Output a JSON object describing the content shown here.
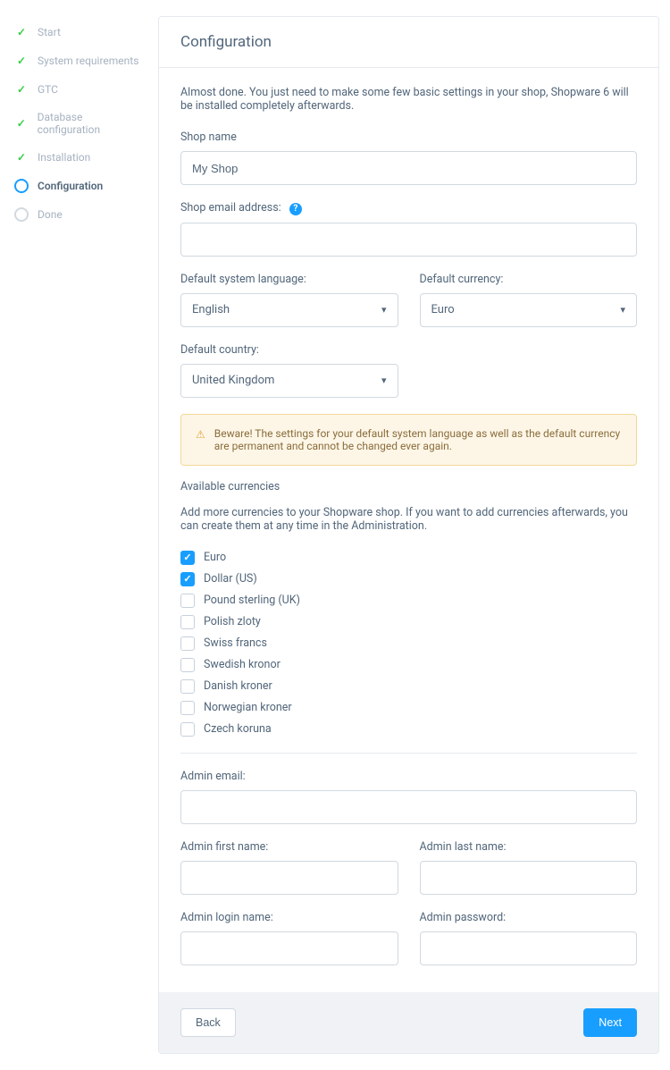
{
  "sidebar": {
    "steps": [
      {
        "label": "Start",
        "state": "done"
      },
      {
        "label": "System requirements",
        "state": "done"
      },
      {
        "label": "GTC",
        "state": "done"
      },
      {
        "label": "Database configuration",
        "state": "done"
      },
      {
        "label": "Installation",
        "state": "done"
      },
      {
        "label": "Configuration",
        "state": "current"
      },
      {
        "label": "Done",
        "state": "pending"
      }
    ]
  },
  "header": {
    "title": "Configuration"
  },
  "intro": "Almost done. You just need to make some few basic settings in your shop, Shopware 6 will be installed completely afterwards.",
  "form": {
    "shop_name_label": "Shop name",
    "shop_name_value": "My Shop",
    "shop_email_label": "Shop email address:",
    "shop_email_value": "",
    "default_lang_label": "Default system language:",
    "default_lang_value": "English",
    "default_currency_label": "Default currency:",
    "default_currency_value": "Euro",
    "default_country_label": "Default country:",
    "default_country_value": "United Kingdom",
    "warning": "Beware! The settings for your default system language as well as the default currency are permanent and cannot be changed ever again.",
    "available_currencies_label": "Available currencies",
    "available_currencies_desc": "Add more currencies to your Shopware shop. If you want to add currencies afterwards, you can create them at any time in the Administration.",
    "currencies": [
      {
        "label": "Euro",
        "checked": true
      },
      {
        "label": "Dollar (US)",
        "checked": true
      },
      {
        "label": "Pound sterling (UK)",
        "checked": false
      },
      {
        "label": "Polish zloty",
        "checked": false
      },
      {
        "label": "Swiss francs",
        "checked": false
      },
      {
        "label": "Swedish kronor",
        "checked": false
      },
      {
        "label": "Danish kroner",
        "checked": false
      },
      {
        "label": "Norwegian kroner",
        "checked": false
      },
      {
        "label": "Czech koruna",
        "checked": false
      }
    ],
    "admin_email_label": "Admin email:",
    "admin_first_label": "Admin first name:",
    "admin_last_label": "Admin last name:",
    "admin_login_label": "Admin login name:",
    "admin_password_label": "Admin password:"
  },
  "footer": {
    "back": "Back",
    "next": "Next"
  }
}
